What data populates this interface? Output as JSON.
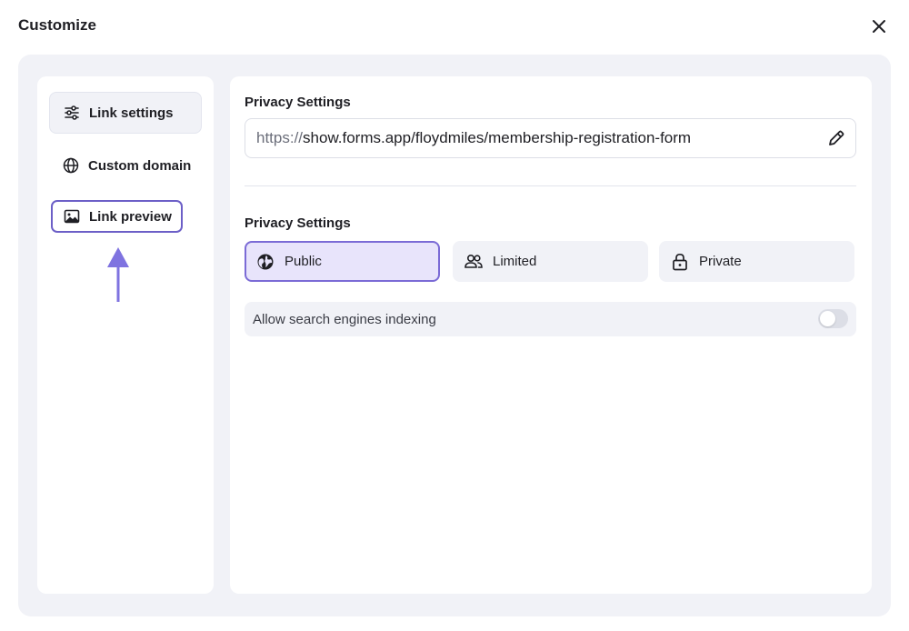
{
  "dialog": {
    "title": "Customize",
    "close_icon": "close-icon"
  },
  "sidebar": {
    "items": [
      {
        "label": "Link settings",
        "icon": "sliders-icon",
        "active": true
      },
      {
        "label": "Custom domain",
        "icon": "globe-icon",
        "active": false
      },
      {
        "label": "Link preview",
        "icon": "image-icon",
        "active": false,
        "highlighted": true
      }
    ],
    "annotation_arrow": {
      "color": "#7f73e0",
      "points_to": "Link preview"
    }
  },
  "content": {
    "link_section_label": "Privacy Settings",
    "url": {
      "prefix": "https://",
      "value": "show.forms.app/floydmiles/membership-registration-form",
      "edit_icon": "pencil-icon"
    },
    "privacy_section_label": "Privacy Settings",
    "privacy_options": [
      {
        "label": "Public",
        "icon": "globe-filled-icon",
        "selected": true
      },
      {
        "label": "Limited",
        "icon": "users-icon",
        "selected": false
      },
      {
        "label": "Private",
        "icon": "lock-icon",
        "selected": false
      }
    ],
    "indexing": {
      "label": "Allow search engines indexing",
      "enabled": false
    }
  },
  "colors": {
    "accent": "#7b6bd6",
    "accent_light": "#e8e4fb",
    "panel_bg": "#f1f2f7"
  }
}
